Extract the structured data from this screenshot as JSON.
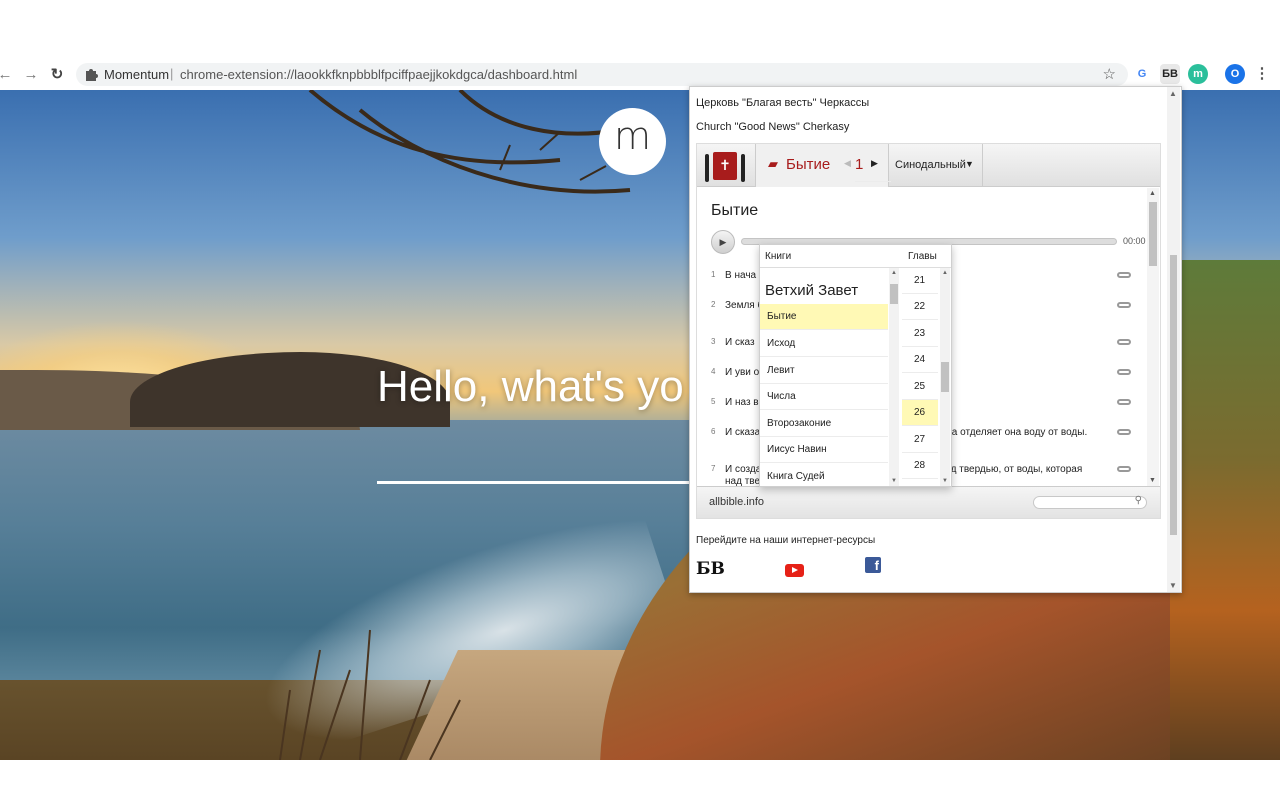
{
  "browser": {
    "back": "←",
    "forward": "→",
    "reload": "↻",
    "site_name": "Momentum",
    "separator": "|",
    "url": "chrome-extension://laookkfknpbbblfpciffpaejjkokdgca/dashboard.html",
    "star": "☆",
    "extensions": [
      {
        "label": "G",
        "color": "#4285f4"
      },
      {
        "label": "БВ",
        "color": "#222222"
      },
      {
        "label": "m",
        "color": "#2bbf9b"
      }
    ],
    "profile_initial": "O",
    "menu": "⋮"
  },
  "momentum": {
    "logo_letter": "m",
    "greeting": "Hello, what's yo"
  },
  "popup": {
    "church_ru": "Церковь \"Благая весть\" Черкассы",
    "church_en": "Church \"Good News\" Cherkasy",
    "toolbar": {
      "book": "Бытие",
      "chapter": "1",
      "translation": "Синодальный"
    },
    "chapter_title": "Бытие",
    "audio_time": "00:00",
    "verses": [
      {
        "num": "1",
        "text": "В нача"
      },
      {
        "num": "2",
        "text": "Земля                                                   бездною, и Дух Божий носился над во"
      },
      {
        "num": "3",
        "text": "И сказ"
      },
      {
        "num": "4",
        "text": "И уви                                                      ог свет от тьмы."
      },
      {
        "num": "5",
        "text": "И наз                                                        вечер, и было утро: день один."
      },
      {
        "num": "6",
        "text": "И сказал Бог: да будет твердь посреди воды, и да отделяет она воду от воды."
      },
      {
        "num": "7",
        "text": "И создал Бог твердь, и отделил воду, которая под твердью, от воды, которая над твердью. И стало так."
      }
    ],
    "dropdown": {
      "books_header": "Книги",
      "chapters_header": "Главы",
      "section": "Ветхий Завет",
      "books": [
        "Бытие",
        "Исход",
        "Левит",
        "Числа",
        "Второзаконие",
        "Иисус Навин",
        "Книга Судей"
      ],
      "selected_book": "Бытие",
      "chapters": [
        "21",
        "22",
        "23",
        "24",
        "25",
        "26",
        "27",
        "28"
      ],
      "selected_chapter": "26"
    },
    "footer_site": "allbible.info",
    "goto_text": "Перейдите на наши интернет-ресурсы",
    "social": {
      "bv": "БВ",
      "fb": "f"
    }
  }
}
